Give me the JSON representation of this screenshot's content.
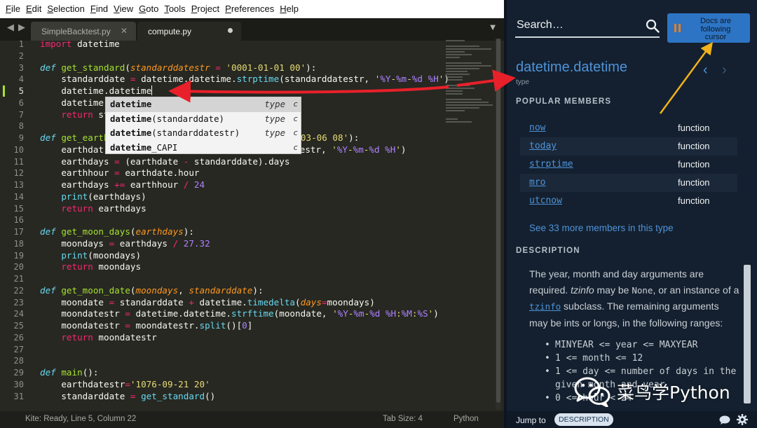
{
  "menubar": [
    "File",
    "Edit",
    "Selection",
    "Find",
    "View",
    "Goto",
    "Tools",
    "Project",
    "Preferences",
    "Help"
  ],
  "tabs": [
    {
      "label": "SimpleBacktest.py",
      "active": false
    },
    {
      "label": "compute.py",
      "active": true
    }
  ],
  "line_numbers": [
    "1",
    "2",
    "3",
    "4",
    "5",
    "6",
    "7",
    "8",
    "9",
    "10",
    "11",
    "12",
    "13",
    "14",
    "15",
    "16",
    "17",
    "18",
    "19",
    "20",
    "21",
    "22",
    "23",
    "24",
    "25",
    "26",
    "27",
    "28",
    "29",
    "30",
    "31"
  ],
  "current_line": "5",
  "code": {
    "l1": {
      "kw": "import",
      "text": " datetime"
    },
    "l3": {
      "def": "def",
      "fn": "get_standard",
      "param": "standarddatestr",
      "eq": " = ",
      "str": "'0001-01-01 00'",
      "end": "):"
    },
    "l4": {
      "a": "    standarddate ",
      "eq": "=",
      "b": " datetime.datetime.",
      "call": "strptime",
      "c": "(standarddatestr, ",
      "s1": "'",
      "fmt1": "%Y",
      "s2": "-",
      "fmt2": "%m",
      "s3": "-",
      "fmt3": "%d",
      "s4": " ",
      "fmt4": "%H",
      "s5": "'",
      "d": ")"
    },
    "l5": {
      "text": "    datetime.datetime"
    },
    "l6": {
      "text": "    datetime"
    },
    "l7": {
      "kw": "    return",
      "text": " st"
    },
    "l9": {
      "def": "def",
      "fn": "get_earth",
      "str": "019-03-06 08'",
      "end": "):"
    },
    "l10": {
      "a": "    earthdat",
      "b": "datestr, ",
      "s1": "'",
      "fmt1": "%Y",
      "s2": "-",
      "fmt2": "%m",
      "s3": "-",
      "fmt3": "%d",
      "s4": " ",
      "fmt4": "%H",
      "s5": "'",
      "d": ")"
    },
    "l11": {
      "a": "    earthdays ",
      "eq": "=",
      "b": " (earthdate ",
      "op": "-",
      "c": " standarddate).days"
    },
    "l12": {
      "a": "    earthhour ",
      "eq": "=",
      "b": " earthdate.hour"
    },
    "l13": {
      "a": "    earthdays ",
      "op1": "+=",
      "b": " earthhour ",
      "op2": "/",
      "num": " 24"
    },
    "l14": {
      "bi": "    print",
      "text": "(earthdays)"
    },
    "l15": {
      "kw": "    return",
      "text": " earthdays"
    },
    "l17": {
      "def": "def",
      "fn": "get_moon_days",
      "p0": "(",
      "param": "earthdays",
      "end": "):"
    },
    "l18": {
      "a": "    moondays ",
      "eq": "=",
      "b": " earthdays ",
      "op": "/",
      "num": " 27.32"
    },
    "l19": {
      "bi": "    print",
      "text": "(moondays)"
    },
    "l20": {
      "kw": "    return",
      "text": " moondays"
    },
    "l22": {
      "def": "def",
      "fn": "get_moon_date",
      "p0": "(",
      "param1": "moondays",
      "sep": ", ",
      "param2": "standarddate",
      "end": "):"
    },
    "l23": {
      "a": "    moondate ",
      "eq": "=",
      "b": " standarddate ",
      "op": "+",
      "c": " datetime.",
      "call": "timedelta",
      "p0": "(",
      "kwarg": "days",
      "eq2": "=",
      "d": "moondays)"
    },
    "l24": {
      "a": "    moondatestr ",
      "eq": "=",
      "b": " datetime.datetime.",
      "call": "strftime",
      "c": "(moondate, ",
      "s1": "'",
      "fmt1": "%Y",
      "s2": "-",
      "fmt2": "%m",
      "s3": "-",
      "fmt3": "%d",
      "s4": " ",
      "fmt4": "%H",
      "s5": ":",
      "fmt5": "%M",
      "s6": ":",
      "fmt6": "%S",
      "s7": "'",
      "d": ")"
    },
    "l25": {
      "a": "    moondatestr ",
      "eq": "=",
      "b": " moondatestr.",
      "call": "split",
      "c": "()[",
      "num": "0",
      "d": "]"
    },
    "l26": {
      "kw": "    return",
      "text": " moondatestr"
    },
    "l29": {
      "def": "def",
      "fn": "main",
      "end": "():"
    },
    "l30": {
      "a": "    earthdatestr",
      "eq": "=",
      "str": "'1076-09-21 20'"
    },
    "l31": {
      "a": "    standarddate ",
      "eq": "=",
      "b": " ",
      "call": "get_standard",
      "c": "()"
    }
  },
  "autocomplete": [
    {
      "match": "datetime",
      "rest": "",
      "kind": "type",
      "hint": "c"
    },
    {
      "match": "datetime",
      "rest": "(standarddate)",
      "kind": "type",
      "hint": "c"
    },
    {
      "match": "datetime",
      "rest": "(standarddatestr)",
      "kind": "type",
      "hint": "c"
    },
    {
      "match": "datetime",
      "rest": "_CAPI",
      "kind": "",
      "hint": "c"
    }
  ],
  "statusbar": {
    "left": "Kite: Ready, Line 5, Column 22",
    "tab_size": "Tab Size: 4",
    "syntax": "Python"
  },
  "docs": {
    "search_placeholder": "Search…",
    "follow_button": "Docs are following cursor",
    "title": "datetime.datetime",
    "subtitle": "type",
    "popular_heading": "POPULAR MEMBERS",
    "members": [
      {
        "name": "now",
        "kind": "function"
      },
      {
        "name": "today",
        "kind": "function"
      },
      {
        "name": "strptime",
        "kind": "function"
      },
      {
        "name": "mro",
        "kind": "function"
      },
      {
        "name": "utcnow",
        "kind": "function"
      }
    ],
    "see_more": "See 33 more members in this type",
    "description_heading": "DESCRIPTION",
    "desc": {
      "p1": "The year, month and day arguments are required. ",
      "tzinfo_italic": "tzinfo",
      "p2": " may be ",
      "none": "None",
      "p3": ", or an instance of a ",
      "tzinfo_link": "tzinfo",
      "p4": " subclass. The remaining arguments may be ints or longs, in the following ranges:"
    },
    "bullets": [
      "MINYEAR <= year <= MAXYEAR",
      "1 <= month <= 12",
      "1 <= day <= number of days in the given month and year",
      "0 <= hour < 24"
    ],
    "jump_to": "Jump to",
    "jump_pill": "DESCRIPTION"
  },
  "watermark": "菜鸟学Python",
  "colors": {
    "editor_bg": "#272822",
    "docs_bg": "#14202f",
    "accent_blue": "#4e93d9",
    "arrow_red": "#e8202a",
    "arrow_yellow": "#f2b21b"
  }
}
